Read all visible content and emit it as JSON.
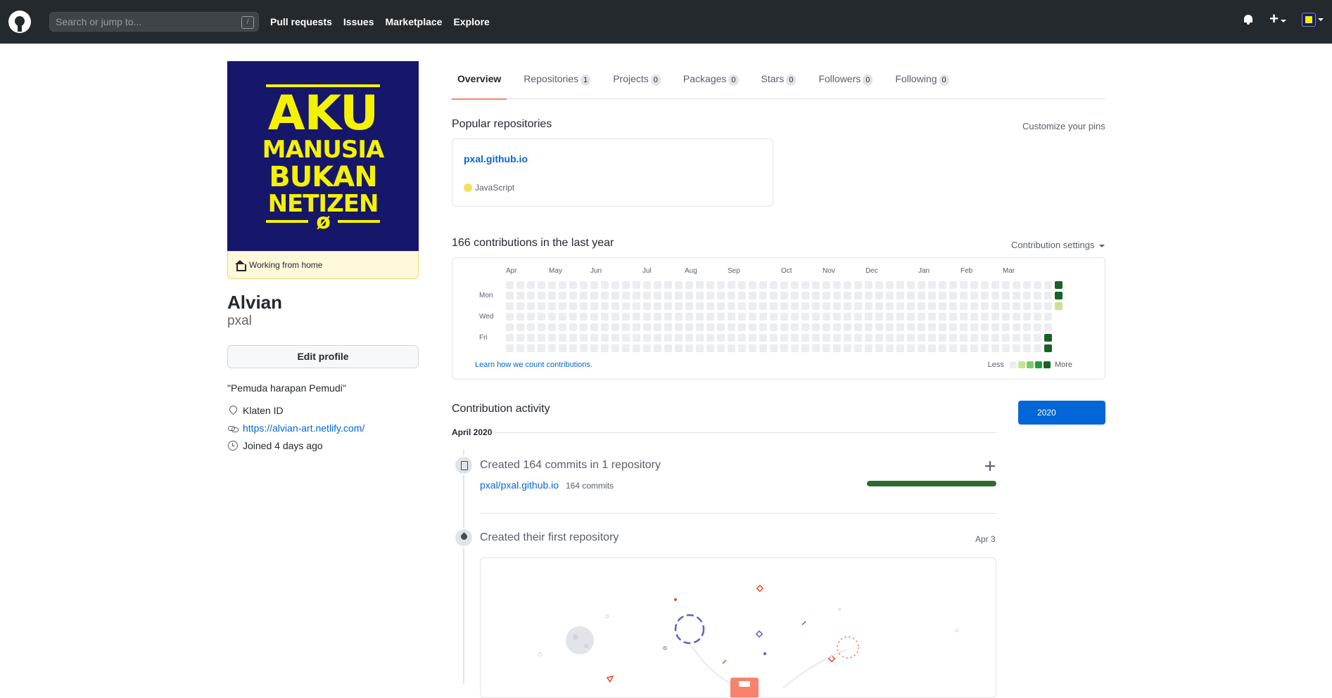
{
  "header": {
    "search_placeholder": "Search or jump to...",
    "search_shortcut": "/",
    "nav": [
      "Pull requests",
      "Issues",
      "Marketplace",
      "Explore"
    ]
  },
  "profile": {
    "avatar_text": [
      "AKU",
      "MANUSIA",
      "BUKAN",
      "NETIZEN",
      "ø"
    ],
    "status": "Working from home",
    "name": "Alvian",
    "username": "pxal",
    "edit_button": "Edit profile",
    "bio": "\"Pemuda harapan Pemudi\"",
    "location": "Klaten ID",
    "website": "https://alvian-art.netlify.com/",
    "joined": "Joined 4 days ago"
  },
  "tabs": [
    {
      "label": "Overview",
      "count": null
    },
    {
      "label": "Repositories",
      "count": "1"
    },
    {
      "label": "Projects",
      "count": "0"
    },
    {
      "label": "Packages",
      "count": "0"
    },
    {
      "label": "Stars",
      "count": "0"
    },
    {
      "label": "Followers",
      "count": "0"
    },
    {
      "label": "Following",
      "count": "0"
    }
  ],
  "popular": {
    "title": "Popular repositories",
    "customize": "Customize your pins",
    "repo_name": "pxal.github.io",
    "language": "JavaScript",
    "language_color": "#f1e05a"
  },
  "contributions": {
    "title": "166 contributions in the last year",
    "settings": "Contribution settings",
    "months": [
      "Apr",
      "May",
      "Jun",
      "Jul",
      "Aug",
      "Sep",
      "Oct",
      "Nov",
      "Dec",
      "Jan",
      "Feb",
      "Mar"
    ],
    "days": [
      "Mon",
      "Wed",
      "Fri"
    ],
    "learn": "Learn how we count contributions.",
    "legend_less": "Less",
    "legend_more": "More",
    "colors": [
      "#ebedf0",
      "#c6e48b",
      "#7bc96f",
      "#239a3b",
      "#196127"
    ]
  },
  "activity": {
    "title": "Contribution activity",
    "year": "2020",
    "month": "April 2020",
    "commits_title": "Created 164 commits in 1 repository",
    "repo": "pxal/pxal.github.io",
    "repo_commits": "164 commits",
    "first_repo_title": "Created their first repository",
    "first_repo_date": "Apr 3"
  }
}
